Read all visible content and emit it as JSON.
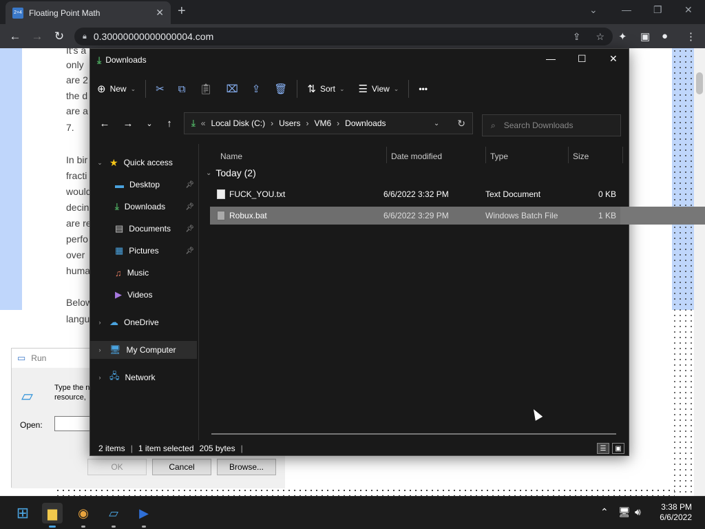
{
  "browser": {
    "tab_title": "Floating Point Math",
    "tab_favicon": "2+4",
    "url": "0.30000000000000004.com"
  },
  "webpage": {
    "lines": [
      "It's a",
      "only",
      "are 2",
      "the d",
      "are a",
      "7.",
      "In bir",
      "fracti",
      "would",
      "decin",
      "are re",
      "perfo",
      "over",
      "huma",
      "Below",
      "langu"
    ]
  },
  "run_dialog": {
    "title": "Run",
    "description_line1": "Type the n",
    "description_line2": "resource,",
    "open_label": "Open:",
    "ok_label": "OK",
    "cancel_label": "Cancel",
    "browse_label": "Browse..."
  },
  "explorer": {
    "title": "Downloads",
    "ribbon": {
      "new_label": "New",
      "sort_label": "Sort",
      "view_label": "View",
      "more_label": "•••"
    },
    "address": {
      "prefix": "«",
      "crumbs": [
        "Local Disk (C:)",
        "Users",
        "VM6",
        "Downloads"
      ]
    },
    "search_placeholder": "Search Downloads",
    "nav": {
      "quick_access": "Quick access",
      "items": [
        "Desktop",
        "Downloads",
        "Documents",
        "Pictures",
        "Music",
        "Videos"
      ],
      "onedrive": "OneDrive",
      "my_computer": "My Computer",
      "network": "Network"
    },
    "columns": [
      "Name",
      "Date modified",
      "Type",
      "Size"
    ],
    "group_label": "Today (2)",
    "files": [
      {
        "name": "FUCK_YOU.txt",
        "date": "6/6/2022 3:32 PM",
        "type": "Text Document",
        "size": "0 KB"
      },
      {
        "name": "Robux.bat",
        "date": "6/6/2022 3:29 PM",
        "type": "Windows Batch File",
        "size": "1 KB"
      }
    ],
    "status": {
      "items": "2 items",
      "selected": "1 item selected",
      "bytes": "205 bytes"
    }
  },
  "taskbar": {
    "time": "3:38 PM",
    "date": "6/6/2022"
  }
}
